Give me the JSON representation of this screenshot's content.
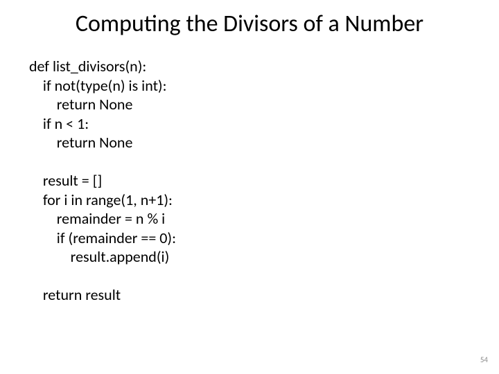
{
  "title": "Computing the Divisors of a Number",
  "code_lines": [
    "def list_divisors(n):",
    "    if not(type(n) is int):",
    "        return None",
    "    if n < 1:",
    "        return None",
    "",
    "    result = []",
    "    for i in range(1, n+1):",
    "        remainder = n % i",
    "        if (remainder == 0):",
    "            result.append(i)",
    "",
    "    return result"
  ],
  "page_number": "54"
}
